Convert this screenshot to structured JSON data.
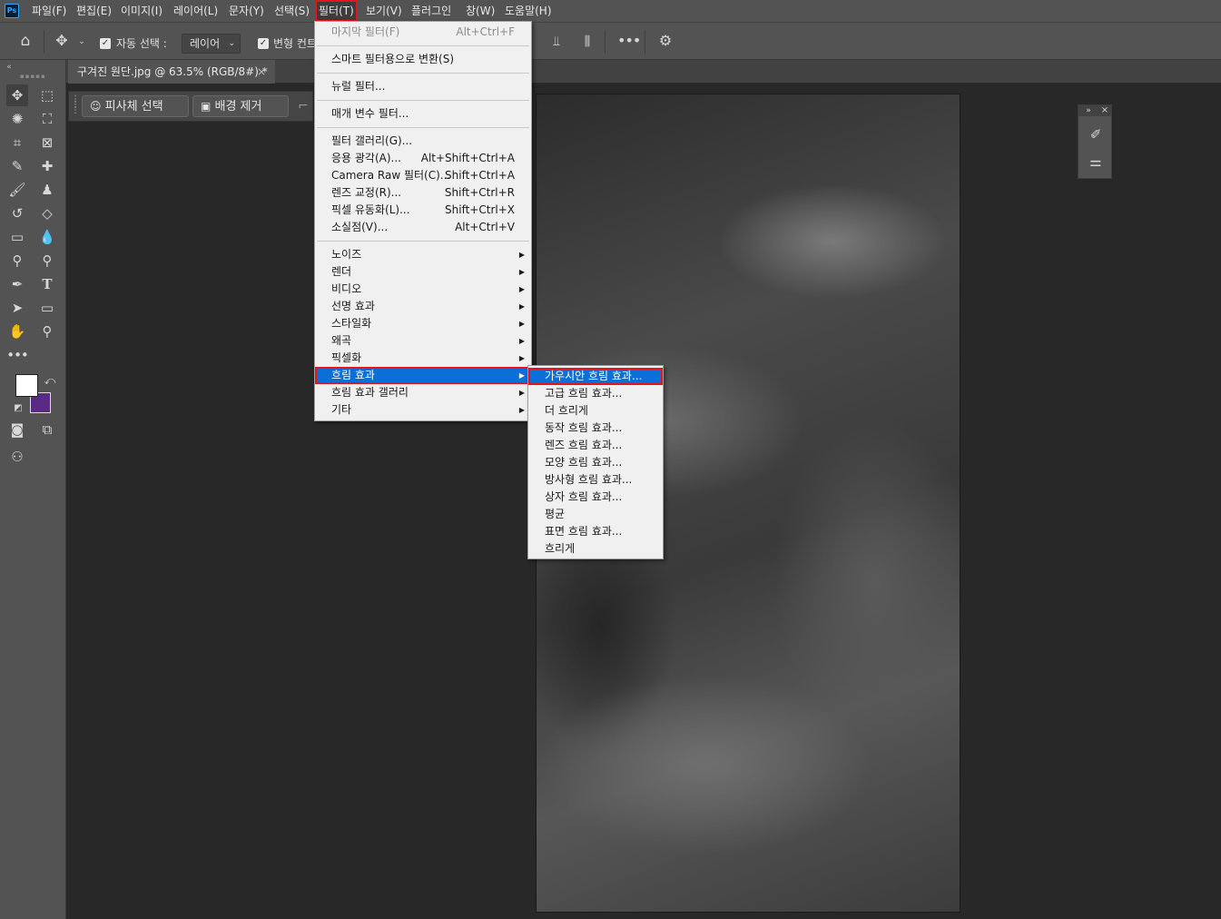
{
  "app": {
    "logo": "Ps"
  },
  "menubar": {
    "items": [
      "파일(F)",
      "편집(E)",
      "이미지(I)",
      "레이어(L)",
      "문자(Y)",
      "선택(S)",
      "필터(T)",
      "보기(V)",
      "플러그인",
      "창(W)",
      "도움말(H)"
    ],
    "active_index": 6
  },
  "options_bar": {
    "auto_select_label": "자동 선택 :",
    "auto_select_checked": true,
    "auto_select_value": "레이어",
    "transform_label": "변형 컨트",
    "transform_checked": true
  },
  "document": {
    "tab_title": "구겨진 원단.jpg @ 63.5% (RGB/8#) *",
    "close_glyph": "×"
  },
  "context_bar": {
    "select_subject": "피사체 선택",
    "remove_background": "배경 제거"
  },
  "colors": {
    "foreground": "#ffffff",
    "background": "#5b2a86",
    "menu_highlight": "#0a6fd6",
    "annotation_box": "#e8141a"
  },
  "filter_menu": {
    "items": [
      {
        "label": "마지막 필터(F)",
        "shortcut": "Alt+Ctrl+F",
        "disabled": true
      },
      {
        "sep": true
      },
      {
        "label": "스마트 필터용으로 변환(S)"
      },
      {
        "sep": true
      },
      {
        "label": "뉴럴 필터..."
      },
      {
        "sep": true
      },
      {
        "label": "매개 변수 필터..."
      },
      {
        "sep": true
      },
      {
        "label": "필터 갤러리(G)..."
      },
      {
        "label": "응용 광각(A)...",
        "shortcut": "Alt+Shift+Ctrl+A"
      },
      {
        "label": "Camera Raw 필터(C)...",
        "shortcut": "Shift+Ctrl+A"
      },
      {
        "label": "렌즈 교정(R)...",
        "shortcut": "Shift+Ctrl+R"
      },
      {
        "label": "픽셀 유동화(L)...",
        "shortcut": "Shift+Ctrl+X"
      },
      {
        "label": "소실점(V)...",
        "shortcut": "Alt+Ctrl+V"
      },
      {
        "sep": true
      },
      {
        "label": "노이즈",
        "submenu": true
      },
      {
        "label": "렌더",
        "submenu": true
      },
      {
        "label": "비디오",
        "submenu": true
      },
      {
        "label": "선명 효과",
        "submenu": true
      },
      {
        "label": "스타일화",
        "submenu": true
      },
      {
        "label": "왜곡",
        "submenu": true
      },
      {
        "label": "픽셀화",
        "submenu": true
      },
      {
        "label": "흐림 효과",
        "submenu": true,
        "highlighted": true
      },
      {
        "label": "흐림 효과 갤러리",
        "submenu": true
      },
      {
        "label": "기타",
        "submenu": true
      }
    ]
  },
  "blur_submenu": {
    "items": [
      {
        "label": "가우시안 흐림 효과...",
        "highlighted": true
      },
      {
        "label": "고급 흐림 효과..."
      },
      {
        "label": "더 흐리게"
      },
      {
        "label": "동작 흐림 효과..."
      },
      {
        "label": "렌즈 흐림 효과..."
      },
      {
        "label": "모양 흐림 효과..."
      },
      {
        "label": "방사형 흐림 효과..."
      },
      {
        "label": "상자 흐림 효과..."
      },
      {
        "label": "평균"
      },
      {
        "label": "표면 흐림 효과..."
      },
      {
        "label": "흐리게"
      }
    ]
  }
}
